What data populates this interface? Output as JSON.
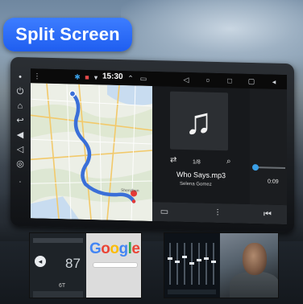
{
  "badge": {
    "label": "Split Screen"
  },
  "status_bar": {
    "time": "15:30"
  },
  "music": {
    "track_count": "1/8",
    "title": "Who Says.mp3",
    "artist": "Selena Gomez",
    "elapsed": "0:09",
    "icons": [
      "repeat-icon",
      "search-icon",
      "folder-icon",
      "equalizer-icon",
      "previous-icon"
    ]
  },
  "thumbnails": {
    "dial_value": "87",
    "dial_label": "6T",
    "search_engine": "Google"
  },
  "colors": {
    "badge": "#1f5ef0",
    "route": "#3a6fd8",
    "accent": "#3aa0e8"
  }
}
